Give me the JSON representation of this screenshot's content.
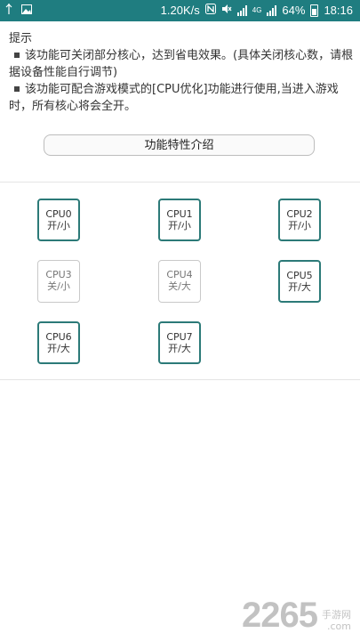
{
  "status_bar": {
    "speed": "1.20K/s",
    "network": "4G",
    "battery": "64%",
    "time": "18:16",
    "icons": [
      "usb-icon",
      "image-icon",
      "nfc-icon",
      "mute-icon",
      "signal-icon",
      "battery-icon"
    ]
  },
  "tips": {
    "title": "提示",
    "line1": "该功能可关闭部分核心，达到省电效果。(具体关闭核心数，请根据设备性能自行调节)",
    "line2": "该功能可配合游戏模式的[CPU优化]功能进行使用,当进入游戏时，所有核心将会全开。"
  },
  "feature_button": "功能特性介绍",
  "cpus": [
    {
      "name": "CPU0",
      "state": "开/小"
    },
    {
      "name": "CPU1",
      "state": "开/小"
    },
    {
      "name": "CPU2",
      "state": "开/小"
    },
    {
      "name": "CPU3",
      "state": "关/小"
    },
    {
      "name": "CPU4",
      "state": "关/大"
    },
    {
      "name": "CPU5",
      "state": "开/大"
    },
    {
      "name": "CPU6",
      "state": "开/大"
    },
    {
      "name": "CPU7",
      "state": "开/大"
    }
  ],
  "watermark": {
    "number": "2265",
    "sub1": "手游网",
    "sub2": ".com"
  },
  "colors": {
    "status_bar": "#1f7d80",
    "cpu_on_border": "#2c7a78",
    "cpu_off_border": "#c9c9c9"
  }
}
